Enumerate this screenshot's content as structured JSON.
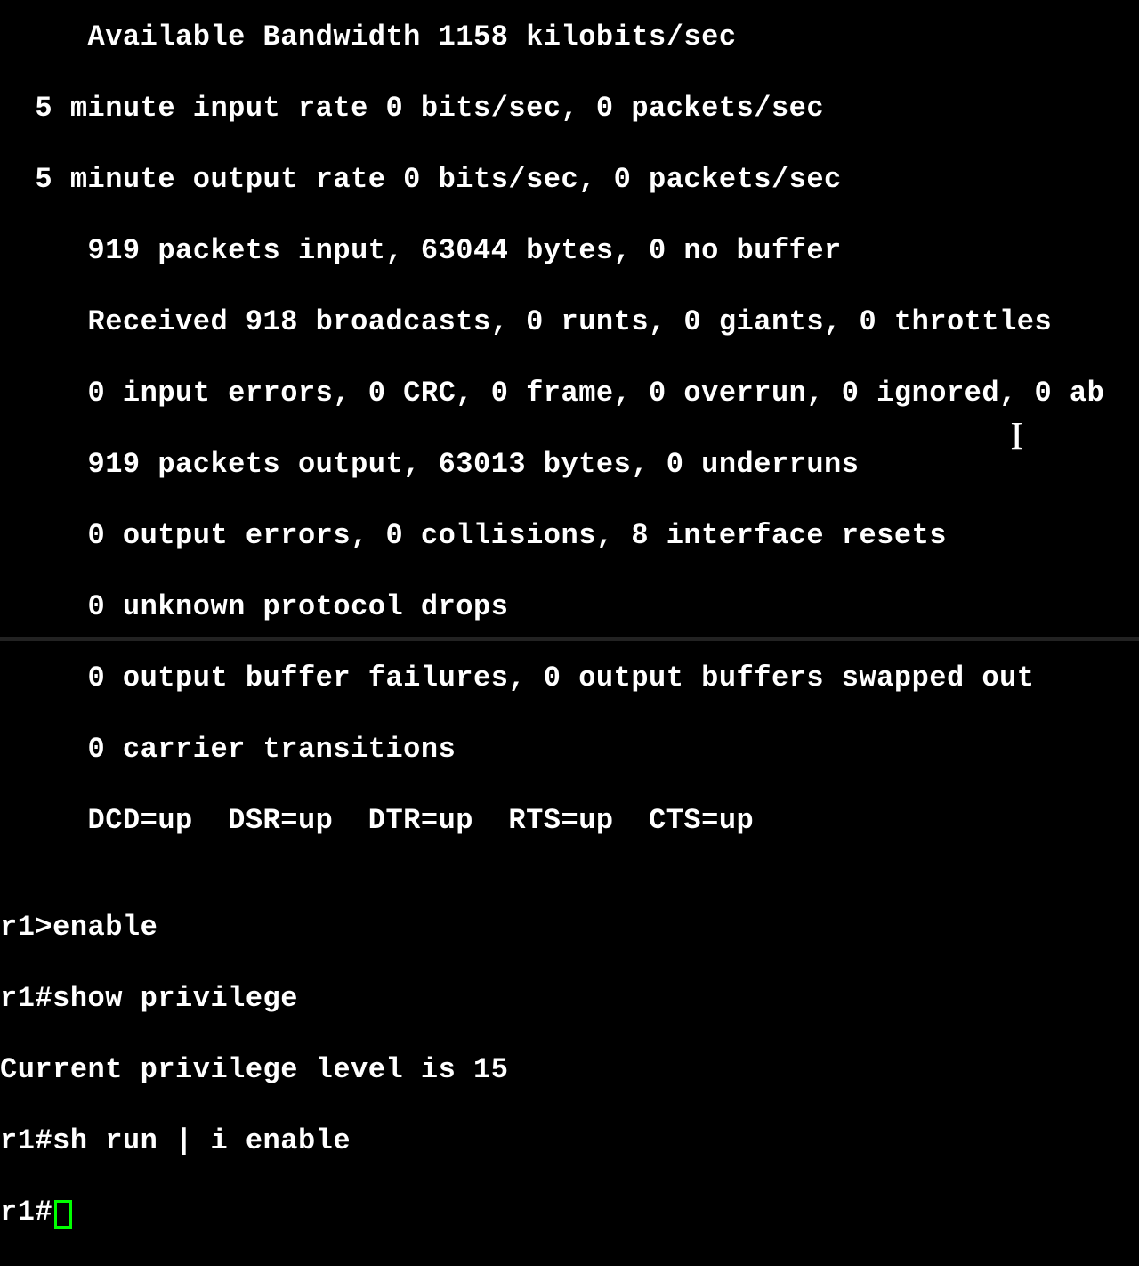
{
  "lines": {
    "l1": "     Available Bandwidth 1158 kilobits/sec",
    "l2": "  5 minute input rate 0 bits/sec, 0 packets/sec",
    "l3": "  5 minute output rate 0 bits/sec, 0 packets/sec",
    "l4": "     919 packets input, 63044 bytes, 0 no buffer",
    "l5": "     Received 918 broadcasts, 0 runts, 0 giants, 0 throttles",
    "l6": "     0 input errors, 0 CRC, 0 frame, 0 overrun, 0 ignored, 0 ab",
    "l7": "     919 packets output, 63013 bytes, 0 underruns",
    "l8": "     0 output errors, 0 collisions, 8 interface resets",
    "l9": "     0 unknown protocol drops",
    "l10": "     0 output buffer failures, 0 output buffers swapped out",
    "l11": "     0 carrier transitions",
    "l12": "     DCD=up  DSR=up  DTR=up  RTS=up  CTS=up",
    "l13": "",
    "l14": "r1>enable",
    "l15": "r1#show privilege",
    "l16": "Current privilege level is 15",
    "l17": "r1#sh run | i enable",
    "prompt": "r1#"
  },
  "cursor_glyph": "I"
}
